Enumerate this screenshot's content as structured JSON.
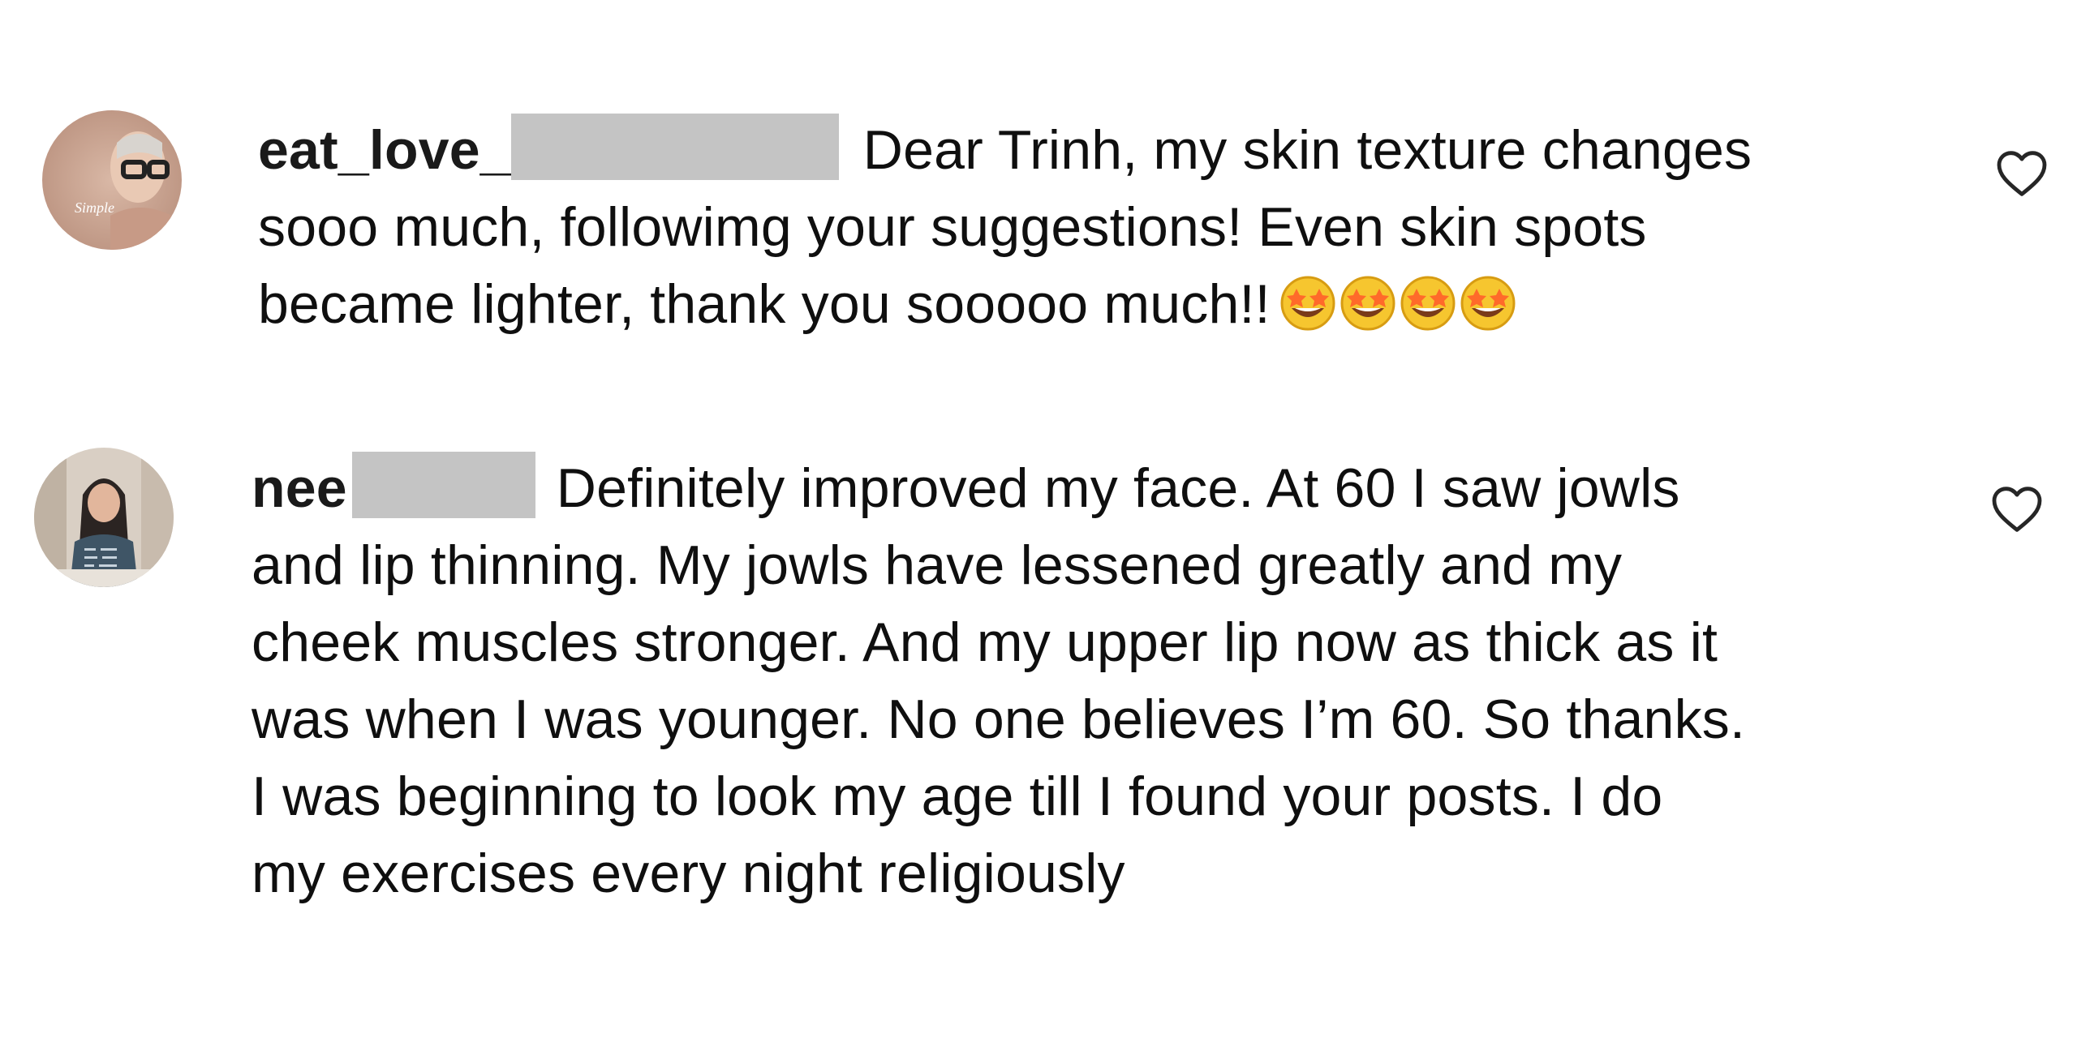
{
  "comments": [
    {
      "username_visible": "eat_love_",
      "lines": [
        "Dear Trinh, my skin texture changes",
        "sooo much, followimg your suggestions! Even skin spots",
        "became lighter, thank you sooooo much!!"
      ],
      "emoji": [
        "star-struck-emoji",
        "star-struck-emoji",
        "star-struck-emoji",
        "star-struck-emoji"
      ],
      "avatar_icon": "avatar-photo-glasses",
      "avatar_text": "Simple",
      "like_icon": "heart-outline-icon"
    },
    {
      "username_visible": "nee",
      "lines": [
        "Definitely improved my face. At 60 I saw jowls",
        "and lip thinning. My jowls have lessened greatly and my",
        "cheek muscles stronger. And my upper lip now as thick as it",
        "was when I was younger. No one believes I’m 60. So thanks.",
        "I was beginning to look my age till I found your posts. I do",
        "my exercises every night religiously"
      ],
      "avatar_icon": "avatar-photo-woman",
      "like_icon": "heart-outline-icon"
    }
  ],
  "colors": {
    "text": "#0f0f0f",
    "redaction": "#c4c4c4",
    "icon": "#262626"
  }
}
